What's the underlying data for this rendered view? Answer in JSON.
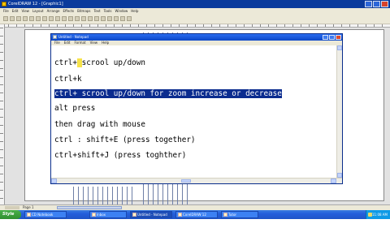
{
  "background_app": {
    "title": "CorelDRAW 12 - [Graphic1]",
    "menu": [
      "File",
      "Edit",
      "View",
      "Layout",
      "Arrange",
      "Effects",
      "Bitmaps",
      "Text",
      "Tools",
      "Window",
      "Help"
    ],
    "page_tab": "Page 1"
  },
  "notepad": {
    "title": "Untitled - Notepad",
    "menu": [
      "File",
      "Edit",
      "Format",
      "View",
      "Help"
    ],
    "lines": [
      {
        "pre": "ctrl+",
        "hl": " ",
        "post": "scrool up/down"
      },
      {
        "text": "ctrl+k"
      },
      {
        "text": "ctrl+ scrool up/down for zoom increase or decrease",
        "selected": true
      },
      {
        "text": "alt press"
      },
      {
        "text": "then drag with mouse"
      },
      {
        "text": "ctrl : shift+E (press together)"
      },
      {
        "text": "ctrl+shift+J (press toghther)"
      }
    ]
  },
  "taskbar": {
    "start_label": "Style XP",
    "tasks": [
      "CD Notebook",
      "Inbox",
      "Untitled - Notepad",
      "CorelDRAW 12",
      "Tutor"
    ],
    "clock": "11:08 AM"
  },
  "colors": {
    "selection": "#0b2c8f",
    "titlebar": "#0b47c8",
    "highlight": "#f6e24a"
  }
}
